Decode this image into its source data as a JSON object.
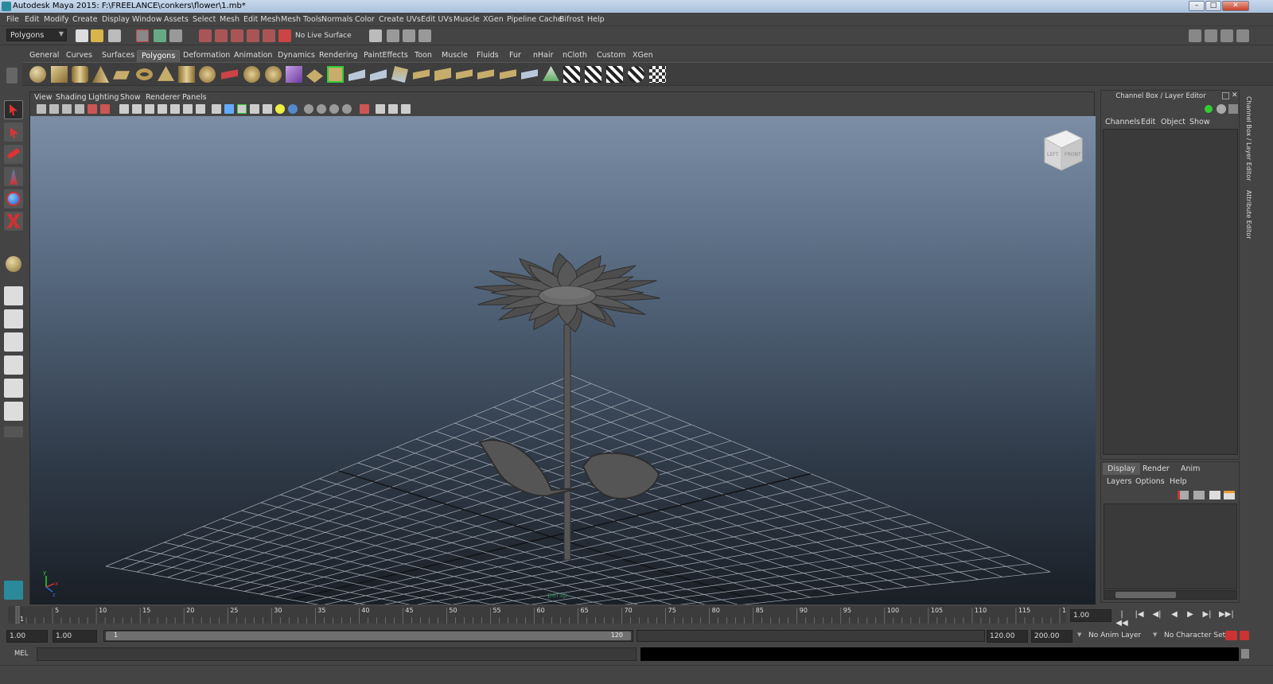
{
  "window": {
    "title": "Autodesk Maya 2015: F:\\FREELANCE\\conkers\\flower\\1.mb*",
    "buttons": [
      "minimize-button",
      "maximize-button",
      "close-button"
    ]
  },
  "menubar": {
    "items": [
      "File",
      "Edit",
      "Modify",
      "Create",
      "Display",
      "Window",
      "Assets",
      "Select",
      "Mesh",
      "Edit Mesh",
      "Mesh Tools",
      "Normals",
      "Color",
      "Create UVs",
      "Edit UVs",
      "Muscle",
      "XGen",
      "Pipeline Cache",
      "Bifrost",
      "Help"
    ]
  },
  "statusline": {
    "menu_set": "Polygons",
    "live_surface": "No Live Surface"
  },
  "shelf": {
    "tabs": [
      "General",
      "Curves",
      "Surfaces",
      "Polygons",
      "Deformation",
      "Animation",
      "Dynamics",
      "Rendering",
      "PaintEffects",
      "Toon",
      "Muscle",
      "Fluids",
      "Fur",
      "nHair",
      "nCloth",
      "Custom",
      "XGen"
    ],
    "active_tab": "Polygons",
    "icons": [
      "poly-sphere-icon",
      "poly-cube-icon",
      "poly-cylinder-icon",
      "poly-cone-icon",
      "poly-plane-icon",
      "poly-torus-icon",
      "poly-pyramid-icon",
      "poly-pipe-icon",
      "poly-helix-icon",
      "poly-soccer-icon",
      "platonic-icon",
      "soccer-ball-icon",
      "poly-combine-icon",
      "poly-separate-icon",
      "extract-icon",
      "smooth-icon",
      "booleans-icon",
      "mirror-icon",
      "append-icon",
      "extrude-icon",
      "bridge-icon",
      "bevel-icon",
      "merge-icon",
      "split-icon",
      "insert-loop-icon",
      "offset-loop-icon",
      "tweak-icon",
      "uv-editor-icon",
      "planar-map-icon",
      "cylindrical-map-icon",
      "spherical-map-icon",
      "automatic-map-icon",
      "checker-icon"
    ]
  },
  "panel": {
    "menus": [
      "View",
      "Shading",
      "Lighting",
      "Show",
      "Renderer",
      "Panels"
    ],
    "camera": "persp",
    "viewcube": {
      "left": "LEFT",
      "front": "FRONT",
      "top": "TOP"
    },
    "axis": {
      "x": "x",
      "y": "y",
      "z": "z"
    }
  },
  "channel_box": {
    "title": "Channel Box / Layer Editor",
    "menus": [
      "Channels",
      "Edit",
      "Object",
      "Show"
    ]
  },
  "layer_editor": {
    "tabs": [
      "Display",
      "Render",
      "Anim"
    ],
    "active_tab": "Display",
    "menus": [
      "Layers",
      "Options",
      "Help"
    ]
  },
  "side_tabs": [
    "Channel Box / Layer Editor",
    "Attribute Editor"
  ],
  "timeline": {
    "ticks": [
      1,
      5,
      10,
      15,
      20,
      25,
      30,
      35,
      40,
      45,
      50,
      55,
      60,
      65,
      70,
      75,
      80,
      85,
      90,
      95,
      100,
      105,
      110,
      115,
      120
    ],
    "min": 1,
    "max": 120,
    "current_frame": 1,
    "current_frame_field": "1.00"
  },
  "range": {
    "start": "1.00",
    "playback_start": "1.00",
    "bar_start": "1",
    "bar_end": "120",
    "playback_end": "120.00",
    "end": "200.00",
    "anim_layer": "No Anim Layer",
    "character_set": "No Character Set"
  },
  "playback_buttons": [
    "|◀◀",
    "|◀",
    "◀|",
    "◀",
    "▶",
    "▶|",
    "▶▶|"
  ],
  "command": {
    "language": "MEL",
    "input": "",
    "output": ""
  }
}
